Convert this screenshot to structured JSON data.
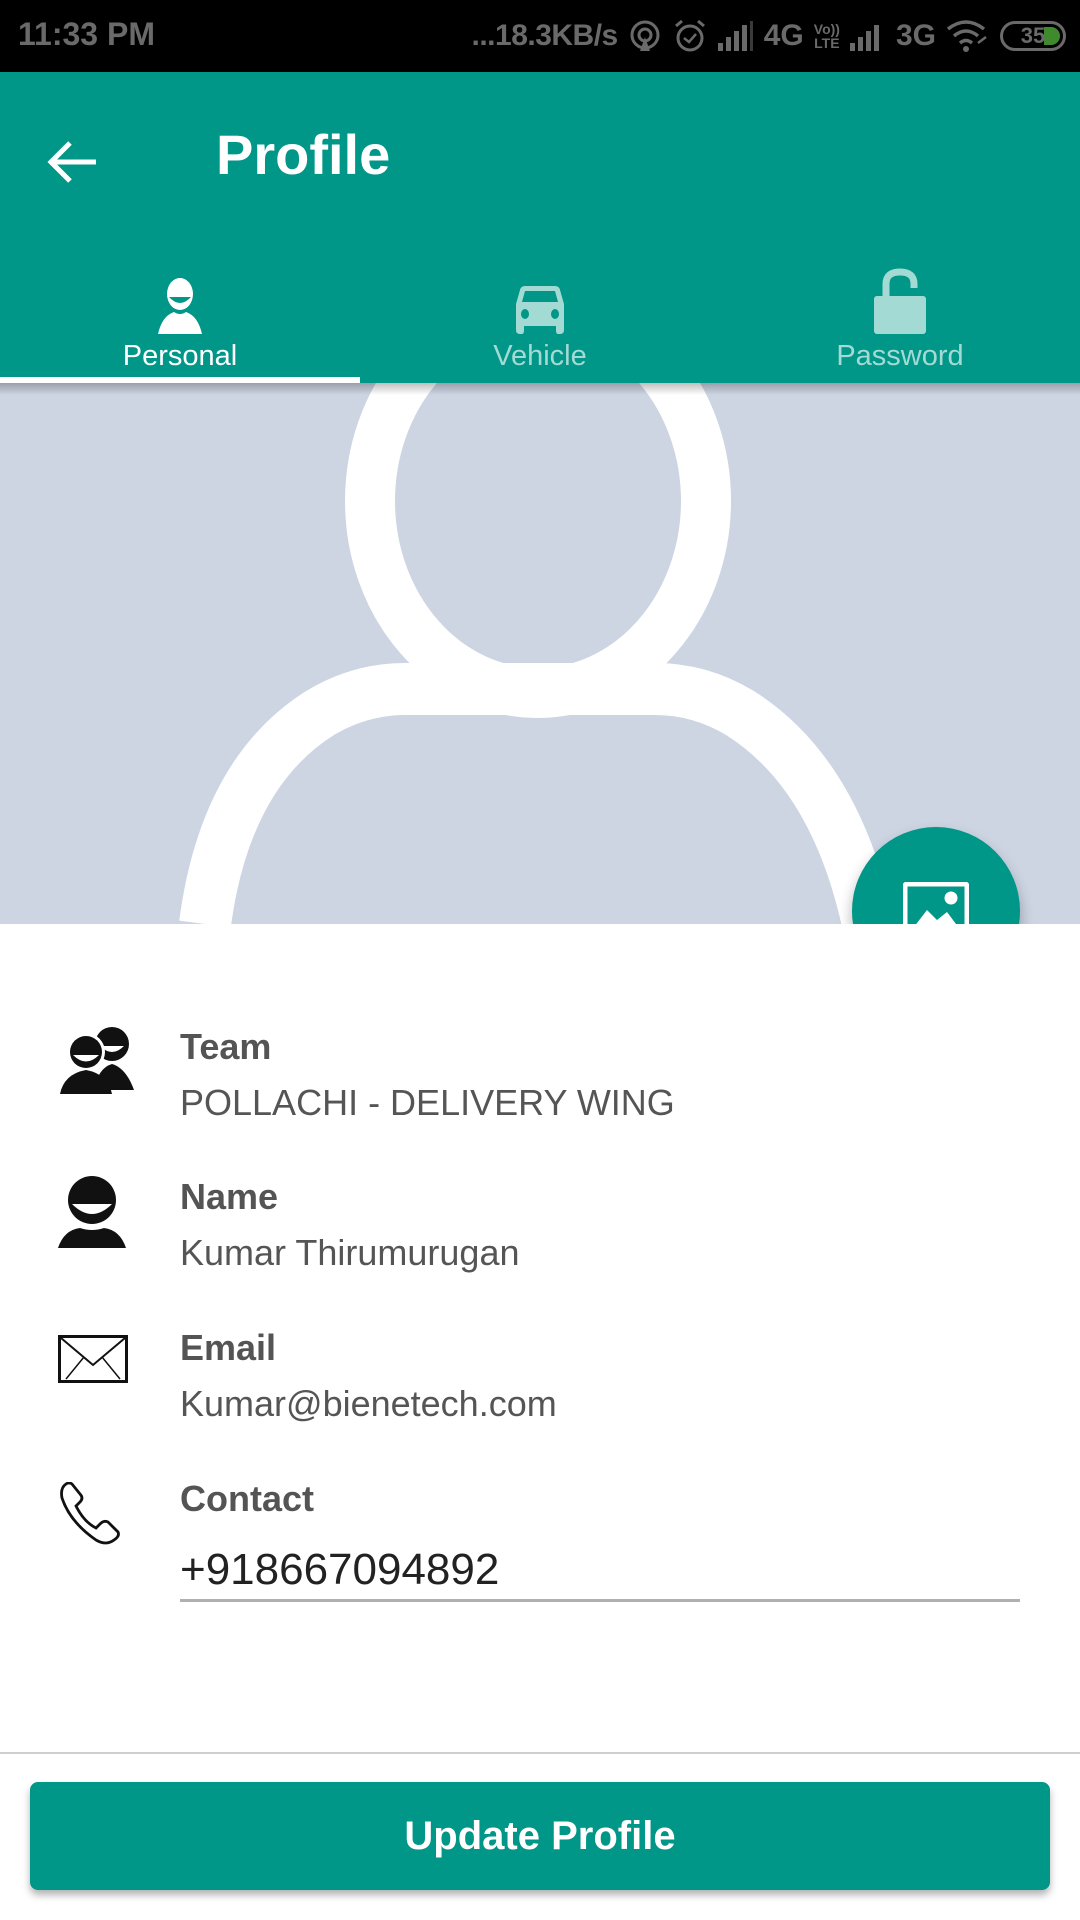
{
  "status_bar": {
    "time": "11:33 PM",
    "net_speed": "...18.3KB/s",
    "network_1": "4G",
    "volte_top": "Vo))",
    "volte_bottom": "LTE",
    "network_2": "3G",
    "battery": "35",
    "icons": [
      "hotspot-icon",
      "alarm-icon",
      "signal-icon",
      "signal-icon",
      "wifi-icon",
      "battery-icon"
    ]
  },
  "app_bar": {
    "title": "Profile",
    "back_icon": "arrow-left-icon"
  },
  "tabs": [
    {
      "label": "Personal",
      "icon": "person-icon",
      "active": true
    },
    {
      "label": "Vehicle",
      "icon": "car-icon",
      "active": false
    },
    {
      "label": "Password",
      "icon": "unlock-icon",
      "active": false
    }
  ],
  "avatar": {
    "placeholder_icon": "person-placeholder-icon",
    "change_photo_icon": "image-icon"
  },
  "fields": {
    "team": {
      "label": "Team",
      "value": "POLLACHI - DELIVERY WING",
      "icon": "team-icon"
    },
    "name": {
      "label": "Name",
      "value": "Kumar Thirumurugan",
      "icon": "person-icon"
    },
    "email": {
      "label": "Email",
      "value": "Kumar@bienetech.com",
      "icon": "envelope-icon"
    },
    "contact": {
      "label": "Contact",
      "value": "+918667094892",
      "icon": "phone-icon"
    }
  },
  "actions": {
    "update_label": "Update Profile"
  },
  "colors": {
    "primary": "#009688",
    "tab_inactive": "#a3dbd4",
    "avatar_bg": "#cdd5e3"
  }
}
